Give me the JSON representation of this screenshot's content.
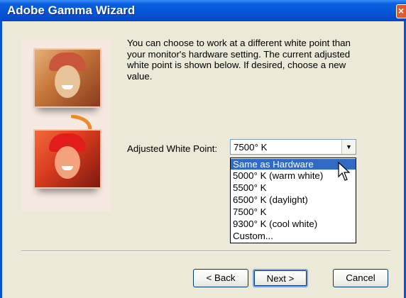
{
  "window": {
    "title": "Adobe Gamma Wizard"
  },
  "intro_text": "You can choose to work at a different white point than your monitor's hardware setting. The current adjusted white point is shown below. If desired, choose a new value.",
  "white_point": {
    "label": "Adjusted White Point:",
    "selected": "7500° K",
    "options": [
      "Same as Hardware",
      "5000° K (warm white)",
      "5500° K",
      "6500° K (daylight)",
      "7500° K",
      "9300° K (cool white)",
      "Custom..."
    ],
    "highlighted_option": "Same as Hardware"
  },
  "buttons": {
    "back": "< Back",
    "next": "Next >",
    "cancel": "Cancel"
  },
  "colors": {
    "titlebar": "#0653d6",
    "highlight": "#316ac5",
    "dialog_bg": "#ece9d8",
    "arrow": "#f08a28"
  },
  "icons": [
    "close-icon",
    "dropdown-arrow-icon",
    "mouse-pointer-icon",
    "curved-arrow-icon"
  ]
}
